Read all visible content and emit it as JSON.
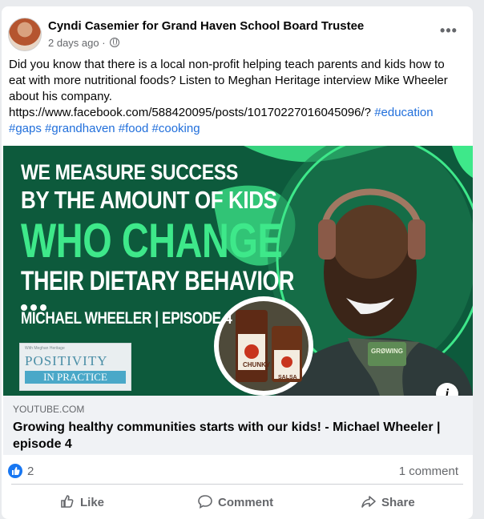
{
  "post": {
    "author": "Cyndi Casemier for Grand Haven School Board Trustee",
    "time": "2 days ago ·",
    "text_line1": "Did you know that there is a local non-profit helping teach parents and kids how to eat with more nutritional foods?  Listen to Meghan Heritage interview Mike Wheeler about his company.",
    "url": "https://www.facebook.com/588420095/posts/10170227016045096/?",
    "hashtags": [
      "#education",
      "#gaps",
      "#grandhaven",
      "#food",
      "#cooking"
    ]
  },
  "media": {
    "headline1": "WE MEASURE SUCCESS",
    "headline2": "BY THE AMOUNT OF KIDS",
    "headline3": "WHO CHANGE",
    "headline4": "THEIR DIETARY BEHAVIOR",
    "byline": "MICHAEL WHEELER | EPISODE 4",
    "logo_top": "POSITIVITY",
    "logo_bottom": "IN PRACTICE",
    "logo_small": "With Meghan Heritage",
    "jar_label1": "CHUNKY",
    "jar_label2": "SALSA",
    "apron_text": "GRØWING",
    "colors": {
      "bg": "#0e5a3d",
      "accent": "#3ee88a"
    }
  },
  "link_preview": {
    "source": "YOUTUBE.COM",
    "title": "Growing healthy communities starts with our kids! - Michael Wheeler | episode 4"
  },
  "stats": {
    "likes": "2",
    "comments": "1 comment"
  },
  "actions": {
    "like": "Like",
    "comment": "Comment",
    "share": "Share"
  }
}
